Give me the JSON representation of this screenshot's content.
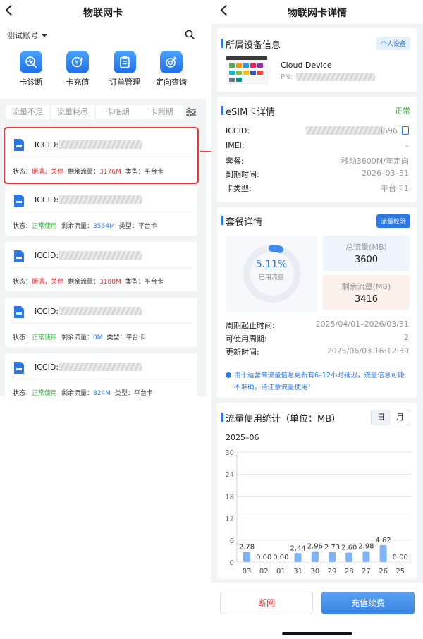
{
  "left": {
    "title": "物联网卡",
    "account": "测试账号",
    "actions": [
      {
        "label": "卡诊断",
        "icon": "diagnosis-icon"
      },
      {
        "label": "卡充值",
        "icon": "recharge-icon"
      },
      {
        "label": "订单管理",
        "icon": "order-icon"
      },
      {
        "label": "定向查询",
        "icon": "targeted-query-icon"
      }
    ],
    "filters": [
      "流量不足",
      "流量耗尽",
      "卡临期",
      "卡到期"
    ],
    "labels": {
      "iccid": "ICCID:",
      "status": "状态：",
      "remaining": "剩余流量：",
      "type": "类型："
    },
    "cards": [
      {
        "status": "期满，关停",
        "status_color": "red",
        "remaining": "3176M",
        "remaining_color": "red",
        "type": "平台卡"
      },
      {
        "status": "正常使用",
        "status_color": "green",
        "remaining": "3554M",
        "remaining_color": "blue",
        "type": "平台卡"
      },
      {
        "status": "期满，关停",
        "status_color": "red",
        "remaining": "3188M",
        "remaining_color": "red",
        "type": "平台卡"
      },
      {
        "status": "正常使用",
        "status_color": "green",
        "remaining": "0M",
        "remaining_color": "blue",
        "type": "平台卡"
      },
      {
        "status": "正常使用",
        "status_color": "green",
        "remaining": "824M",
        "remaining_color": "blue",
        "type": "平台卡"
      }
    ]
  },
  "right": {
    "title": "物联网卡详情",
    "device": {
      "section": "所属设备信息",
      "tag": "个人设备",
      "name": "Cloud Device",
      "pn_label": "PN:"
    },
    "esim": {
      "section": "eSIM卡详情",
      "status": "正常",
      "rows": [
        {
          "key": "ICCID:",
          "value": "i696"
        },
        {
          "key": "IMEI:",
          "value": "–"
        },
        {
          "key": "套餐:",
          "value": "移动3600M/年定向"
        },
        {
          "key": "到期时间:",
          "value": "2026–03–31"
        },
        {
          "key": "卡类型:",
          "value": "平台卡1"
        }
      ]
    },
    "package": {
      "section": "套餐详情",
      "tag": "流量校验",
      "used_percent": "5.11%",
      "used_fraction": 0.0511,
      "used_label": "已用流量",
      "total_label": "总流量(MB)",
      "total_value": "3600",
      "remain_label": "剩余流量(MB)",
      "remain_value": "3416",
      "rows": [
        {
          "key": "周期起止时间:",
          "value": "2025/04/01–2026/03/31"
        },
        {
          "key": "可使用周期:",
          "value": "2"
        },
        {
          "key": "更新时间:",
          "value": "2025/06/03 16:12:39"
        }
      ],
      "notice": "由于运营商流量信息更新有6–12小时延迟，流量信息可能不准确，请注意流量使用！"
    },
    "usage": {
      "section": "流量使用统计（单位：MB）",
      "seg_day": "日",
      "seg_month": "月",
      "period": "2025–06"
    },
    "buttons": {
      "stop": "断网",
      "recharge": "充值续费"
    }
  },
  "colors": {
    "accent": "#2b78e4",
    "danger": "#e53935",
    "ok": "#3cb043"
  },
  "chart_data": {
    "type": "bar",
    "categories": [
      "03",
      "02",
      "01",
      "31",
      "30",
      "29",
      "28",
      "27",
      "26",
      "25"
    ],
    "values": [
      2.78,
      0.0,
      0.0,
      2.44,
      2.96,
      2.73,
      2.6,
      2.98,
      4.62,
      0.0
    ],
    "value_labels": [
      "2.78",
      "0.00",
      "0.00",
      "2.44",
      "2.96",
      "2.73",
      "2.60",
      "2.98",
      "4.62",
      "0.00"
    ],
    "yticks": [
      "0",
      "6",
      "12",
      "18",
      "24",
      "30"
    ],
    "ylim": [
      0,
      30
    ],
    "grid": true
  }
}
